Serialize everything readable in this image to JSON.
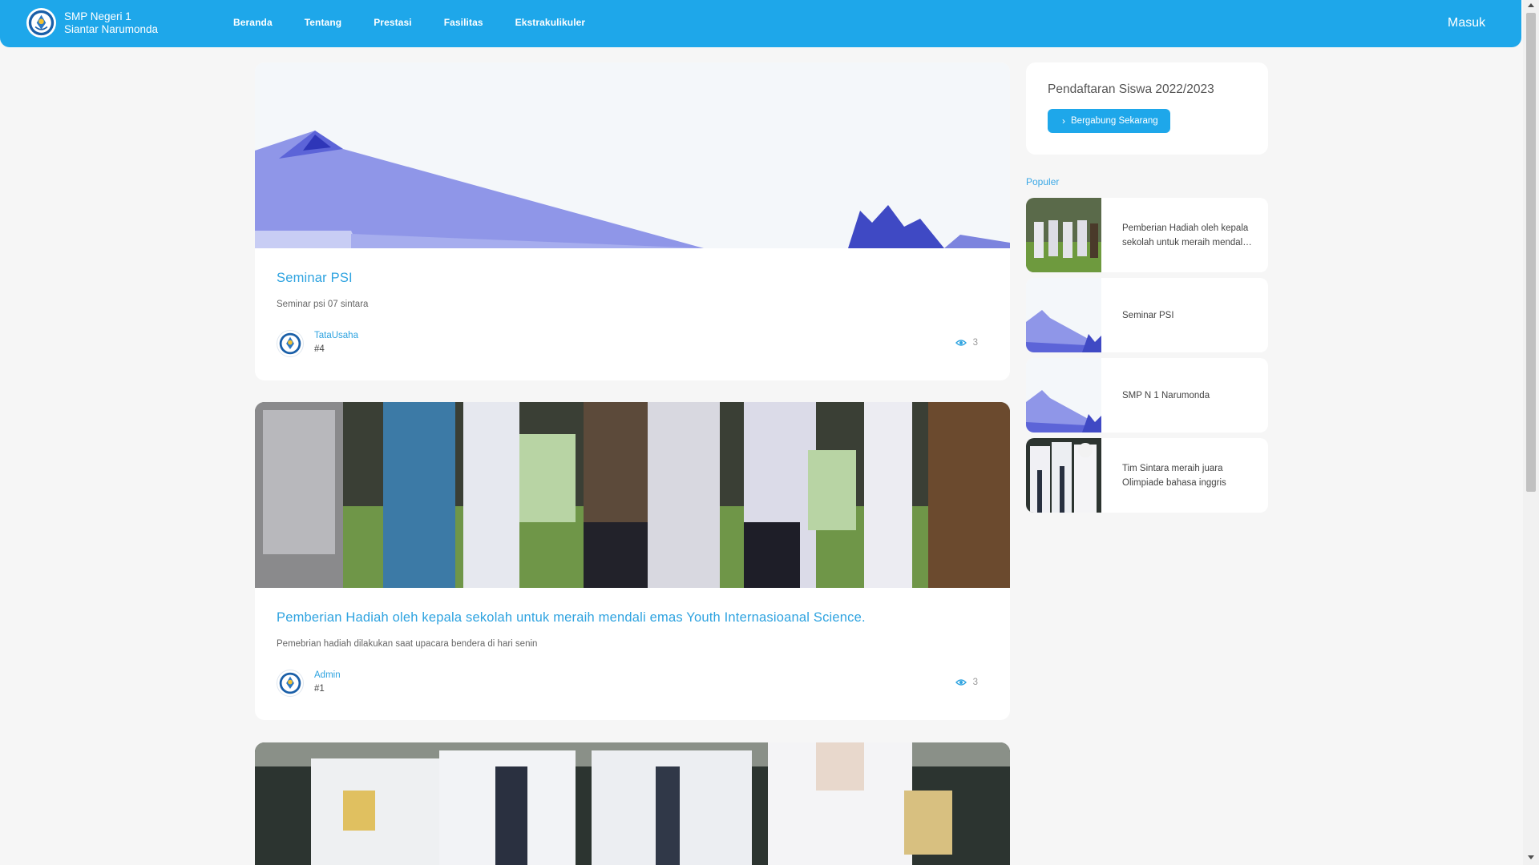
{
  "brand": {
    "line1": "SMP Negeri 1",
    "line2": "Siantar Narumonda"
  },
  "nav": {
    "items": [
      "Beranda",
      "Tentang",
      "Prestasi",
      "Fasilitas",
      "Ekstrakulikuler"
    ],
    "login": "Masuk"
  },
  "posts": [
    {
      "title": "Seminar PSI",
      "description": "Seminar psi 07 sintara",
      "author": "TataUsaha",
      "id": "#4",
      "views": "3"
    },
    {
      "title": "Pemberian Hadiah oleh kepala sekolah untuk meraih mendali emas Youth Internasioanal Science.",
      "description": "Pemebrian hadiah dilakukan saat upacara bendera di hari senin",
      "author": "Admin",
      "id": "#1",
      "views": "3"
    }
  ],
  "registration": {
    "title": "Pendaftaran Siswa 2022/2023",
    "button": "Bergabung Sekarang"
  },
  "popular": {
    "heading": "Populer",
    "items": [
      "Pemberian Hadiah oleh kepala sekolah untuk meraih mendali emas Youth Internasioanal Science.",
      "Seminar PSI",
      "SMP N 1 Narumonda",
      "Tim Sintara meraih juara Olimpiade bahasa inggris"
    ]
  },
  "colors": {
    "primary": "#1ea7ea",
    "link": "#2ea3e0",
    "background": "#f6f6f6"
  },
  "icons": {
    "logo": "tut-wuri-handayani-logo",
    "views": "eye-icon",
    "button": "chevron-right-icon"
  }
}
